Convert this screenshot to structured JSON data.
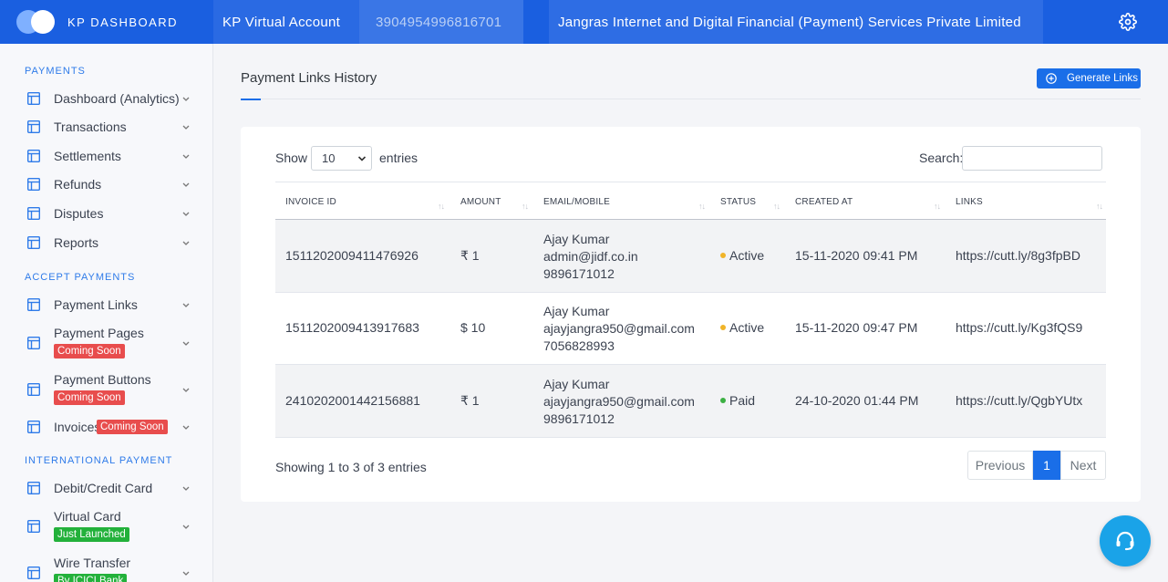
{
  "topbar": {
    "brand": "KP DASHBOARD",
    "account_label": "KP Virtual Account",
    "account_number": "3904954996816701",
    "company": "Jangras Internet and Digital Financial (Payment) Services Private Limited"
  },
  "sidebar": {
    "sections": [
      {
        "title": "PAYMENTS"
      },
      {
        "title": "ACCEPT PAYMENTS"
      },
      {
        "title": "INTERNATIONAL PAYMENT"
      }
    ],
    "items": [
      {
        "label": "Dashboard (Analytics)"
      },
      {
        "label": "Transactions"
      },
      {
        "label": "Settlements"
      },
      {
        "label": "Refunds"
      },
      {
        "label": "Disputes"
      },
      {
        "label": "Reports"
      },
      {
        "label": "Payment Links"
      },
      {
        "label": "Payment Pages",
        "badge": "Coming Soon"
      },
      {
        "label": "Payment Buttons",
        "badge": "Coming Soon"
      },
      {
        "label": "Invoices",
        "badge": "Coming Soon"
      },
      {
        "label": "Debit/Credit Card"
      },
      {
        "label": "Virtual Card",
        "badge": "Just Launched"
      },
      {
        "label": "Wire Transfer",
        "badge": "By ICICI Bank"
      }
    ]
  },
  "main": {
    "title": "Payment Links History",
    "generate_button": "Generate Links",
    "show_label": "Show",
    "entries_select": "10",
    "entries_label": "entries",
    "search_label": "Search:",
    "columns": [
      "INVOICE ID",
      "AMOUNT",
      "EMAIL/MOBILE",
      "STATUS",
      "CREATED AT",
      "LINKS"
    ],
    "rows": [
      {
        "invoice_id": "1511202009411476926",
        "amount": "₹ 1",
        "name": "Ajay Kumar",
        "email": "admin@jidf.co.in",
        "mobile": "9896171012",
        "status": "Active",
        "created_at": "15-11-2020 09:41 PM",
        "link": "https://cutt.ly/8g3fpBD"
      },
      {
        "invoice_id": "1511202009413917683",
        "amount": "$ 10",
        "name": "Ajay Kumar",
        "email": "ajayjangra950@gmail.com",
        "mobile": "7056828993",
        "status": "Active",
        "created_at": "15-11-2020 09:47 PM",
        "link": "https://cutt.ly/Kg3fQS9"
      },
      {
        "invoice_id": "2410202001442156881",
        "amount": "₹ 1",
        "name": "Ajay Kumar",
        "email": "ajayjangra950@gmail.com",
        "mobile": "9896171012",
        "status": "Paid",
        "created_at": "24-10-2020 01:44 PM",
        "link": "https://cutt.ly/QgbYUtx"
      }
    ],
    "info": "Showing 1 to 3 of 3 entries",
    "pagination": {
      "prev": "Previous",
      "current": "1",
      "next": "Next"
    }
  },
  "colors": {
    "primary": "#1a6ee8",
    "topbar": "#1a5fe0",
    "active_status": "#f0b429",
    "paid_status": "#3cb043",
    "badge_red": "#e84d4d",
    "badge_green": "#23b13b"
  }
}
